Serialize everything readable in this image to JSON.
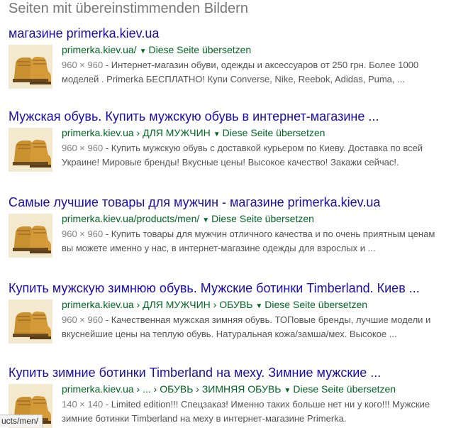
{
  "heading": "Seiten mit übereinstimmenden Bildern",
  "results": [
    {
      "title": "магазине primerka.kiev.ua",
      "url": "primerka.kiev.ua/",
      "translate": "Diese Seite übersetzen",
      "dims": "960 × 960",
      "line1": " - Интернет-магазин обуви, одежды и аксессуаров от 250 грн. Более 1000",
      "line2": "моделей . Primerka БЕСПЛАТНО! Купи Converse, Nike, Reebok, Adidas, Puma, ..."
    },
    {
      "title": "Мужская обувь. Купить мужскую обувь в интернет-магазине ...",
      "url": "primerka.kiev.ua › ДЛЯ МУЖЧИН",
      "translate": "Diese Seite übersetzen",
      "dims": "960 × 960",
      "line1": " - Купить мужскую обувь с доставкой курьером по Киеву. Доставка по всей",
      "line2": "Украине! Мировые бренды! Вкусные цены! Высокое качество! Закажи сейчас!."
    },
    {
      "title": "Самые лучшие товары для мужчин - магазине primerka.kiev.ua",
      "url": "primerka.kiev.ua/products/men/",
      "translate": "Diese Seite übersetzen",
      "dims": "960 × 960",
      "line1": " - Купить товары для мужчин отличного качества и по очень приятным ценам",
      "line2": "вы можете именно у нас, в интернет-магазине одежды для взрослых и ..."
    },
    {
      "title": "Купить мужскую зимнюю обувь. Мужские ботинки Timberland. Киев ...",
      "url": "primerka.kiev.ua › ДЛЯ МУЖЧИН › ОБУВЬ",
      "translate": "Diese Seite übersetzen",
      "dims": "960 × 960",
      "line1": " - Качественная мужская зимняя обувь. ТОПовые бренды, лучшие модели и",
      "line2": "вкуснейшие цены на теплую обувь. Натуральная кожа/замша/мех. Высокое ..."
    },
    {
      "title": "Купить зимние ботинки Timberland на меху. Зимние мужские ...",
      "url": "primerka.kiev.ua › ... › ОБУВЬ › ЗИМНЯЯ ОБУВЬ",
      "translate": "Diese Seite übersetzen",
      "dims": "140 × 140",
      "line1": " - Limited edition!!! Спецзаказ! Именно таких больше нет ни у кого!!! Мужские",
      "line2": "зимние ботинки Timberland на меху в интернет-магазине Primerka."
    }
  ],
  "status_url": "ucts/men/",
  "colors": {
    "title": "#1a0dab",
    "url": "#006621",
    "snippet": "#545454",
    "heading": "#777777"
  },
  "icons": {
    "dropdown": "triangle-down",
    "thumbnail": "boot-image"
  }
}
